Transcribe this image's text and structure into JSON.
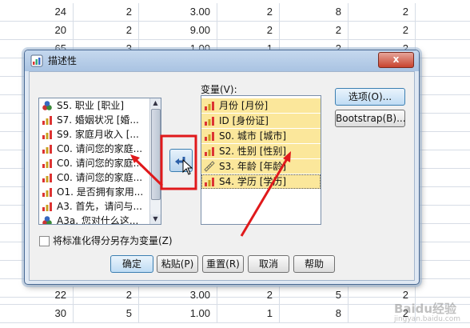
{
  "spreadsheet": {
    "top_rows": [
      [
        "24",
        "2",
        "3.00",
        "2",
        "8",
        "2"
      ],
      [
        "20",
        "2",
        "9.00",
        "2",
        "2",
        "2"
      ],
      [
        "65",
        "3",
        "1.00",
        "1",
        "2",
        "2"
      ]
    ],
    "bottom_rows": [
      [
        "22",
        "2",
        "3.00",
        "2",
        "5",
        "2"
      ],
      [
        "30",
        "5",
        "1.00",
        "1",
        "8",
        "2"
      ]
    ]
  },
  "dialog": {
    "title": "描述性",
    "close_label": "x",
    "variables_label": "变量(V):",
    "source_items": [
      {
        "label": "S5. 职业 [职业]",
        "icon": "nominal-icon"
      },
      {
        "label": "S7. 婚姻状况 [婚...",
        "icon": "ordinal-icon"
      },
      {
        "label": "S9. 家庭月收入 [...",
        "icon": "ordinal-icon"
      },
      {
        "label": "C0. 请问您的家庭...",
        "icon": "ordinal-icon"
      },
      {
        "label": "C0. 请问您的家庭...",
        "icon": "ordinal-icon"
      },
      {
        "label": "C0. 请问您的家庭...",
        "icon": "ordinal-icon"
      },
      {
        "label": "O1. 是否拥有家用...",
        "icon": "ordinal-icon"
      },
      {
        "label": "A3. 首先，请问与...",
        "icon": "ordinal-icon"
      },
      {
        "label": "A3a. 您对什么这...",
        "icon": "nominal-icon"
      }
    ],
    "target_items": [
      {
        "label": "月份 [月份]",
        "icon": "ordinal-icon"
      },
      {
        "label": "ID [身份证]",
        "icon": "ordinal-icon"
      },
      {
        "label": "S0. 城市 [城市]",
        "icon": "ordinal-icon"
      },
      {
        "label": "S2. 性别 [性别]",
        "icon": "ordinal-icon"
      },
      {
        "label": "S3. 年龄 [年龄]",
        "icon": "scale-ruler-icon"
      },
      {
        "label": "S4. 学历 [学历]",
        "icon": "ordinal-icon"
      }
    ],
    "options_button": "选项(O)...",
    "bootstrap_button": "Bootstrap(B)...",
    "save_standardized_label": "将标准化得分另存为变量(Z)",
    "buttons": {
      "ok": "确定",
      "paste": "粘贴(P)",
      "reset": "重置(R)",
      "cancel": "取消",
      "help": "帮助"
    }
  },
  "watermark": {
    "brand": "Baidu经验",
    "sub": "jingyan.baidu.com"
  },
  "colors": {
    "annotation_red": "#e0191b",
    "selected_var_bg": "#fbe79b",
    "dialog_bg": "#dfe8f3"
  }
}
